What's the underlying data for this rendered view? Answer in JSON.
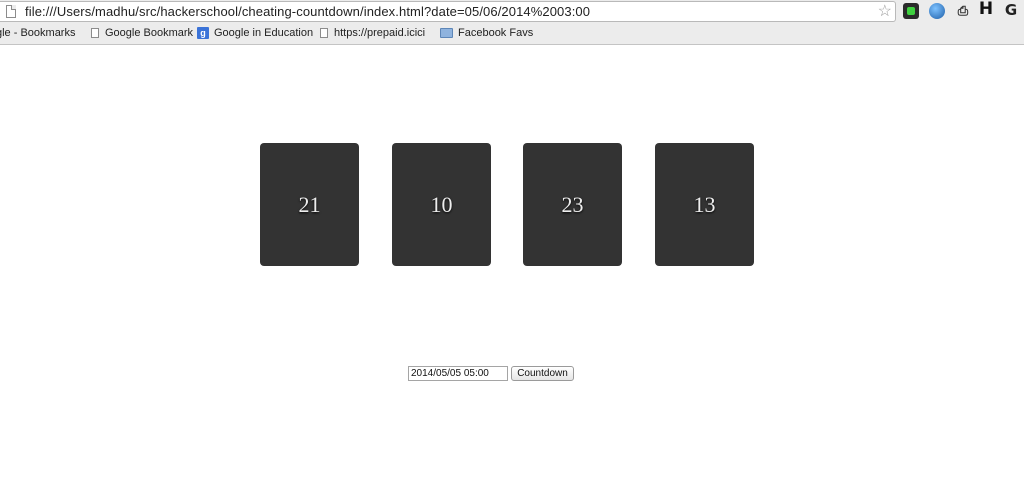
{
  "browser": {
    "url": "file:///Users/madhu/src/hackerschool/cheating-countdown/index.html?date=05/06/2014%2003:00",
    "bookmarks": [
      {
        "label": "gle - Bookmarks",
        "icon": "none"
      },
      {
        "label": "Google Bookmark",
        "icon": "page-icon"
      },
      {
        "label": "Google in Education",
        "icon": "google-icon"
      },
      {
        "label": "https://prepaid.icici",
        "icon": "page-icon"
      },
      {
        "label": "Facebook Favs",
        "icon": "folder-icon"
      }
    ],
    "extensions": [
      "green-square-icon",
      "globe-icon",
      "document-icon",
      "h-icon",
      "g-icon"
    ],
    "ext_labels": {
      "h": "H",
      "g": "G"
    },
    "google_badge": "g"
  },
  "countdown": {
    "values": [
      "21",
      "10",
      "23",
      "13"
    ]
  },
  "form": {
    "date_value": "2014/05/05 05:00",
    "button_label": "Countdown"
  },
  "colors": {
    "tile": "#333333",
    "tile_text": "#eeeeee"
  }
}
